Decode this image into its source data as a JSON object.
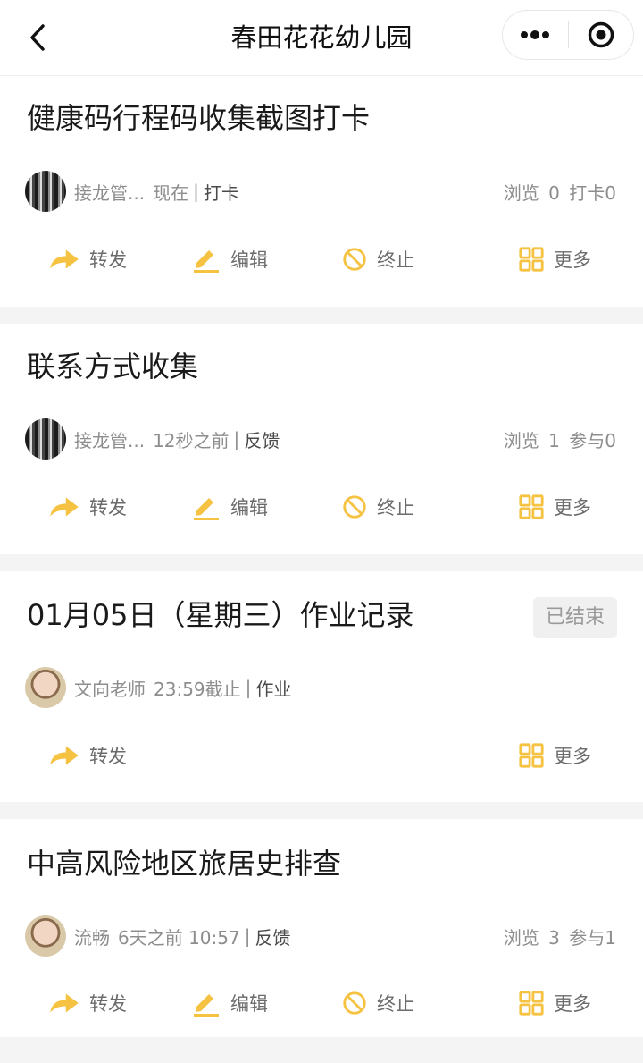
{
  "navbar": {
    "title": "春田花花幼儿园",
    "back_icon": "chevron-left-icon",
    "menu_icon": "more-dots-icon",
    "close_icon": "target-circle-icon"
  },
  "colors": {
    "accent": "#f5c242",
    "muted_text": "#8d8d8d",
    "badge_bg": "#f0f0f0"
  },
  "actions": {
    "forward": "转发",
    "edit": "编辑",
    "stop": "终止",
    "more": "更多"
  },
  "cards": [
    {
      "title": "健康码行程码收集截图打卡",
      "author": "接龙管...",
      "time": "现在",
      "type": "打卡",
      "stats": "浏览 0 打卡0",
      "avatar": "building-avatar"
    },
    {
      "title": "联系方式收集",
      "author": "接龙管...",
      "time": "12秒之前",
      "type": "反馈",
      "stats": "浏览 1 参与0",
      "avatar": "building-avatar"
    },
    {
      "title": "01月05日（星期三）作业记录",
      "author": "文向老师",
      "time": "23:59截止",
      "type": "作业",
      "badge": "已结束",
      "avatar": "baby-avatar"
    },
    {
      "title": "中高风险地区旅居史排查",
      "author": "流畅",
      "time": "6天之前 10:57",
      "type": "反馈",
      "stats": "浏览 3 参与1",
      "avatar": "baby-avatar"
    }
  ]
}
